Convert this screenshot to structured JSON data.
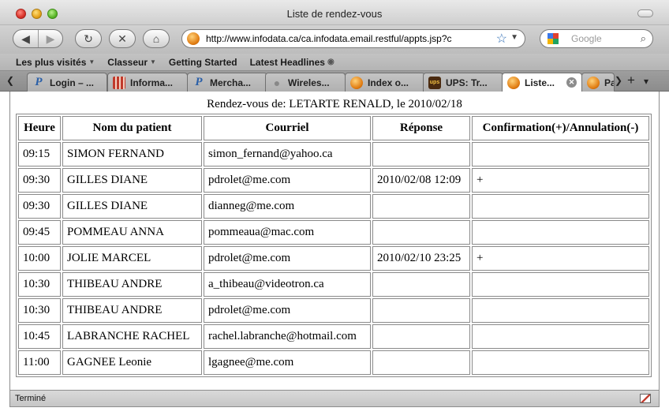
{
  "window": {
    "title": "Liste de rendez-vous"
  },
  "nav": {
    "back_glyph": "◀",
    "forward_glyph": "▶",
    "reload_glyph": "↻",
    "stop_glyph": "✕",
    "home_glyph": "⌂",
    "url": "http://www.infodata.ca/ca.infodata.email.restful/appts.jsp?c",
    "search_placeholder": "Google"
  },
  "bookmarks": {
    "items": [
      "Les plus visités",
      "Classeur",
      "Getting Started",
      "Latest Headlines"
    ]
  },
  "tabs": [
    {
      "label": "Login – ...",
      "icon": "paypal-icon",
      "glyph": "P"
    },
    {
      "label": "Informa...",
      "icon": "grid-icon",
      "glyph": ""
    },
    {
      "label": "Mercha...",
      "icon": "paypal-icon",
      "glyph": "P"
    },
    {
      "label": "Wireles...",
      "icon": "apple-icon",
      "glyph": ""
    },
    {
      "label": "Index o...",
      "icon": "firefox-icon",
      "glyph": ""
    },
    {
      "label": "UPS: Tr...",
      "icon": "ups-icon",
      "glyph": "ups"
    },
    {
      "label": "Liste...",
      "icon": "firefox-icon",
      "glyph": ""
    },
    {
      "label": "Pa",
      "icon": "firefox-icon",
      "glyph": ""
    }
  ],
  "page": {
    "caption": "Rendez-vous de: LETARTE RENALD, le 2010/02/18",
    "columns": [
      "Heure",
      "Nom du patient",
      "Courriel",
      "Réponse",
      "Confirmation(+)/Annulation(-)"
    ],
    "rows": [
      [
        "09:15",
        "SIMON FERNAND",
        "simon_fernand@yahoo.ca",
        "",
        ""
      ],
      [
        "09:30",
        "GILLES DIANE",
        "pdrolet@me.com",
        "2010/02/08 12:09",
        "+"
      ],
      [
        "09:30",
        "GILLES DIANE",
        "dianneg@me.com",
        "",
        ""
      ],
      [
        "09:45",
        "POMMEAU ANNA",
        "pommeaua@mac.com",
        "",
        ""
      ],
      [
        "10:00",
        "JOLIE MARCEL",
        "pdrolet@me.com",
        "2010/02/10 23:25",
        "+"
      ],
      [
        "10:30",
        "THIBEAU ANDRE",
        "a_thibeau@videotron.ca",
        "",
        ""
      ],
      [
        "10:30",
        "THIBEAU ANDRE",
        "pdrolet@me.com",
        "",
        ""
      ],
      [
        "10:45",
        "LABRANCHE RACHEL",
        "rachel.labranche@hotmail.com",
        "",
        ""
      ],
      [
        "11:00",
        "GAGNEE Leonie",
        "lgagnee@me.com",
        "",
        ""
      ]
    ]
  },
  "status": {
    "text": "Terminé"
  }
}
